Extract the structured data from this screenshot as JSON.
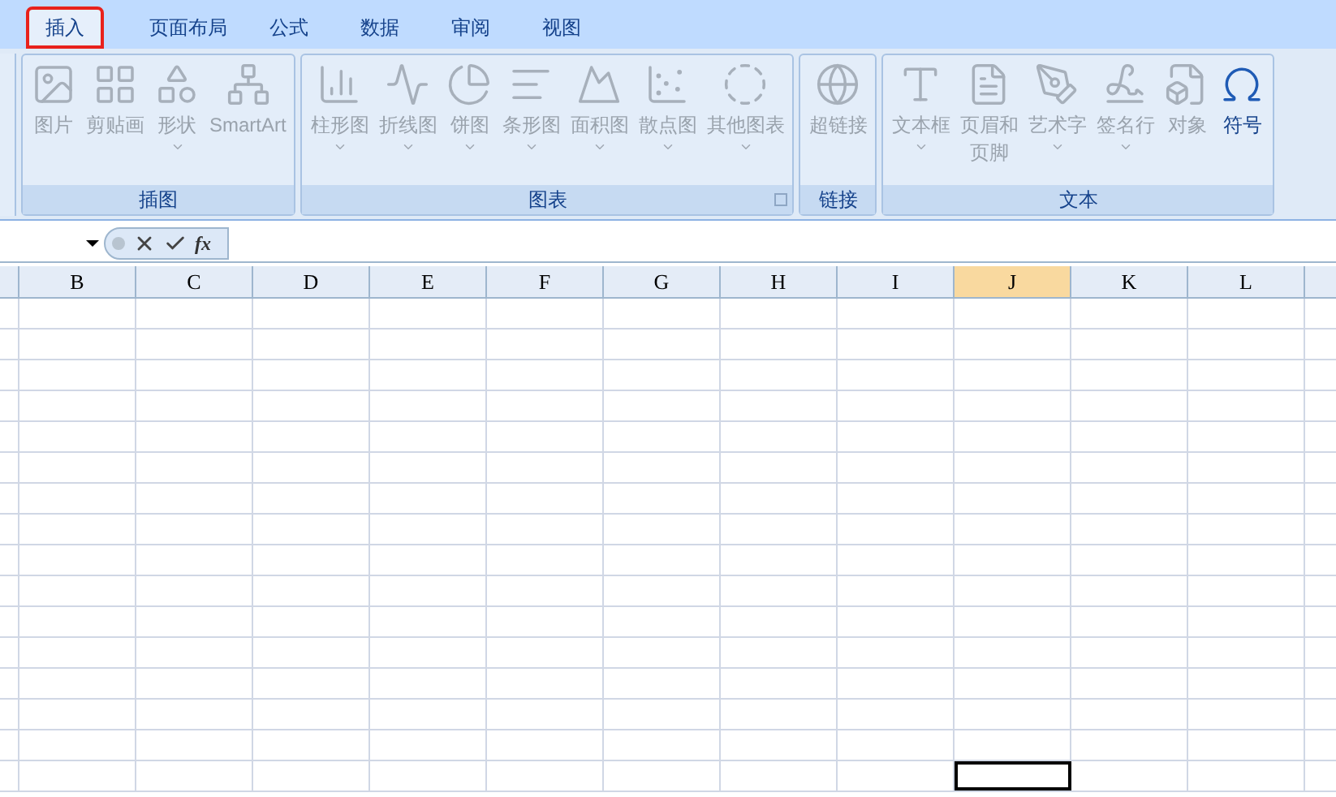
{
  "tabs": [
    {
      "label": "插入",
      "selected": true
    },
    {
      "label": "页面布局",
      "selected": false
    },
    {
      "label": "公式",
      "selected": false
    },
    {
      "label": "数据",
      "selected": false
    },
    {
      "label": "审阅",
      "selected": false
    },
    {
      "label": "视图",
      "selected": false
    }
  ],
  "ribbon_groups": [
    {
      "title": "插图",
      "launcher": false,
      "items": [
        {
          "label": "图片",
          "dropdown": false,
          "disabled": true
        },
        {
          "label": "剪贴画",
          "dropdown": false,
          "disabled": true
        },
        {
          "label": "形状",
          "dropdown": true,
          "disabled": true
        },
        {
          "label": "SmartArt",
          "dropdown": false,
          "disabled": true
        }
      ]
    },
    {
      "title": "图表",
      "launcher": true,
      "items": [
        {
          "label": "柱形图",
          "dropdown": true,
          "disabled": true
        },
        {
          "label": "折线图",
          "dropdown": true,
          "disabled": true
        },
        {
          "label": "饼图",
          "dropdown": true,
          "disabled": true
        },
        {
          "label": "条形图",
          "dropdown": true,
          "disabled": true
        },
        {
          "label": "面积图",
          "dropdown": true,
          "disabled": true
        },
        {
          "label": "散点图",
          "dropdown": true,
          "disabled": true
        },
        {
          "label": "其他图表",
          "dropdown": true,
          "disabled": true
        }
      ]
    },
    {
      "title": "链接",
      "launcher": false,
      "items": [
        {
          "label": "超链接",
          "dropdown": false,
          "disabled": true
        }
      ]
    },
    {
      "title": "文本",
      "launcher": false,
      "items": [
        {
          "label": "文本框",
          "dropdown": true,
          "disabled": true
        },
        {
          "label": "页眉和",
          "label_line_2": "页脚",
          "dropdown": false,
          "disabled": true
        },
        {
          "label": "艺术字",
          "dropdown": true,
          "disabled": true
        },
        {
          "label": "签名行",
          "dropdown": true,
          "disabled": true
        },
        {
          "label": "对象",
          "dropdown": false,
          "disabled": true
        },
        {
          "label": "符号",
          "dropdown": false,
          "disabled": false
        }
      ]
    }
  ],
  "formula_bar": {
    "function_label": "fx"
  },
  "grid": {
    "columns": [
      {
        "label": "B",
        "selected": false
      },
      {
        "label": "C",
        "selected": false
      },
      {
        "label": "D",
        "selected": false
      },
      {
        "label": "E",
        "selected": false
      },
      {
        "label": "F",
        "selected": false
      },
      {
        "label": "G",
        "selected": false
      },
      {
        "label": "H",
        "selected": false
      },
      {
        "label": "I",
        "selected": false
      },
      {
        "label": "J",
        "selected": true
      },
      {
        "label": "K",
        "selected": false
      },
      {
        "label": "L",
        "selected": false
      }
    ],
    "rows": [
      {
        "selected": false
      },
      {
        "selected": false
      },
      {
        "selected": false
      },
      {
        "selected": false
      },
      {
        "selected": false
      },
      {
        "selected": false
      },
      {
        "selected": false
      },
      {
        "selected": false
      },
      {
        "selected": false
      },
      {
        "selected": false
      },
      {
        "selected": false
      },
      {
        "selected": false
      },
      {
        "selected": false
      },
      {
        "selected": false
      },
      {
        "selected": false
      },
      {
        "selected": true
      }
    ]
  }
}
